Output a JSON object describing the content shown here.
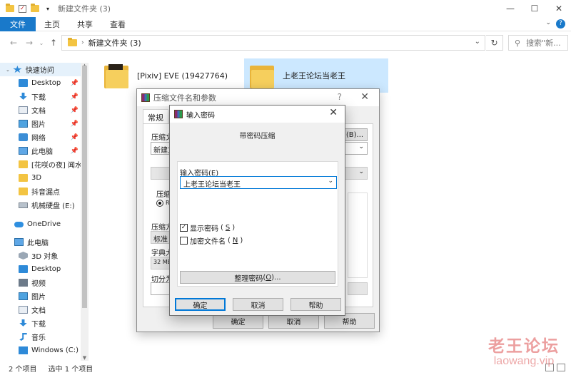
{
  "window": {
    "title": "新建文件夹 (3)",
    "controls": {
      "minimize": "—",
      "maximize": "☐",
      "close": "✕"
    }
  },
  "ribbon": {
    "tabs": [
      "文件",
      "主页",
      "共享",
      "查看"
    ],
    "active_tab": "文件",
    "accent": "#1979ca"
  },
  "address": {
    "path": "新建文件夹 (3)",
    "search_placeholder": "搜索\"新..."
  },
  "nav": {
    "items": [
      {
        "label": "快速访问",
        "icon": "star-icon",
        "pinned": false,
        "highlight": true
      },
      {
        "label": "Desktop",
        "icon": "desktop-icon",
        "pinned": true
      },
      {
        "label": "下载",
        "icon": "download-icon",
        "pinned": true
      },
      {
        "label": "文档",
        "icon": "document-icon",
        "pinned": true
      },
      {
        "label": "图片",
        "icon": "picture-icon",
        "pinned": true
      },
      {
        "label": "网络",
        "icon": "network-icon",
        "pinned": true
      },
      {
        "label": "此电脑",
        "icon": "computer-icon",
        "pinned": true
      },
      {
        "label": "[花咲の夜] 闻水",
        "icon": "folder-icon",
        "pinned": false
      },
      {
        "label": "3D",
        "icon": "folder-icon",
        "pinned": false
      },
      {
        "label": "抖音漏点",
        "icon": "folder-icon",
        "pinned": false
      },
      {
        "label": "机械硬盘 (E:)",
        "icon": "drive-icon",
        "pinned": false
      },
      {
        "label": "OneDrive",
        "icon": "onedrive-icon",
        "pinned": false
      },
      {
        "label": "此电脑",
        "icon": "computer-icon",
        "pinned": false
      },
      {
        "label": "3D 对象",
        "icon": "3d-objects-icon",
        "pinned": false
      },
      {
        "label": "Desktop",
        "icon": "desktop-icon",
        "pinned": false
      },
      {
        "label": "视频",
        "icon": "video-icon",
        "pinned": false
      },
      {
        "label": "图片",
        "icon": "picture-icon",
        "pinned": false
      },
      {
        "label": "文档",
        "icon": "document-icon",
        "pinned": false
      },
      {
        "label": "下载",
        "icon": "download-icon",
        "pinned": false
      },
      {
        "label": "音乐",
        "icon": "music-icon",
        "pinned": false
      },
      {
        "label": "Windows (C:)",
        "icon": "windows-drive-icon",
        "pinned": false
      }
    ]
  },
  "files": [
    {
      "name": "[Pixiv] EVE (19427764)",
      "selected": false
    },
    {
      "name": "上老王论坛当老王",
      "selected": true
    }
  ],
  "status": {
    "count": "2 个项目",
    "selected": "选中 1 个项目"
  },
  "watermark": {
    "cn": "老王论坛",
    "en": "laowang.vip"
  },
  "compress_dialog": {
    "title": "压缩文件名和参数",
    "help": "?",
    "tab": "常规",
    "labels": {
      "archive_name": "压缩文",
      "browse": "(B)...",
      "archive_value": "新建文",
      "format": "压缩",
      "format_radio": "RA",
      "method": "压缩方",
      "method_value": "标准",
      "dict": "字典大",
      "dict_value": "32 MB",
      "split": "切分为"
    },
    "buttons": {
      "ok": "确定",
      "cancel": "取消",
      "help": "帮助"
    }
  },
  "password_dialog": {
    "title": "输入密码",
    "heading": "带密码压缩",
    "input_label": "输入密码",
    "input_label_key": "E",
    "input_value": "上老王论坛当老王",
    "show_password": {
      "label": "显示密码",
      "key": "S",
      "checked": true
    },
    "encrypt_names": {
      "label": "加密文件名",
      "key": "N",
      "checked": false
    },
    "manage_button": {
      "label": "整理密码",
      "key": "O",
      "suffix": "..."
    },
    "buttons": {
      "ok": "确定",
      "cancel": "取消",
      "help": "帮助"
    }
  }
}
